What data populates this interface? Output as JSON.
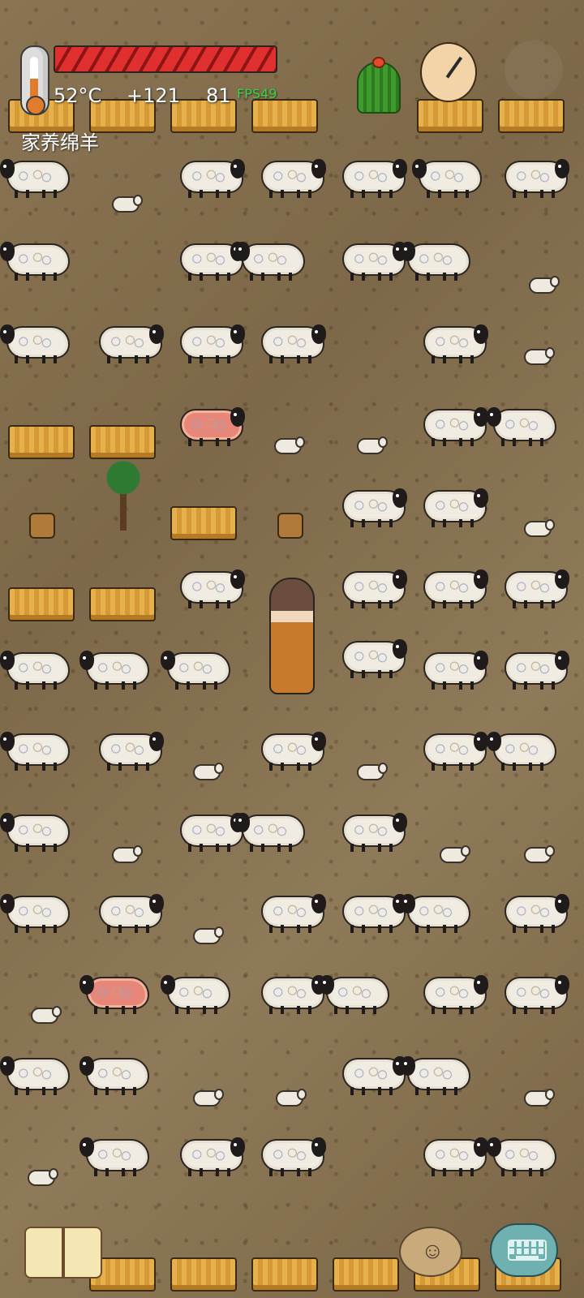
{
  "hud": {
    "temperature": "52°C",
    "delta": "+121",
    "value": "81",
    "fps": "FPS49",
    "health_percent": 100,
    "title": "家养绵羊"
  },
  "icons": {
    "thermometer": "thermometer-icon",
    "cactus": "cactus-icon",
    "clock": "clock-icon",
    "settings": "gear-icon",
    "journal": "book-icon",
    "potato": "potato-icon",
    "keyboard": "keyboard-icon"
  }
}
